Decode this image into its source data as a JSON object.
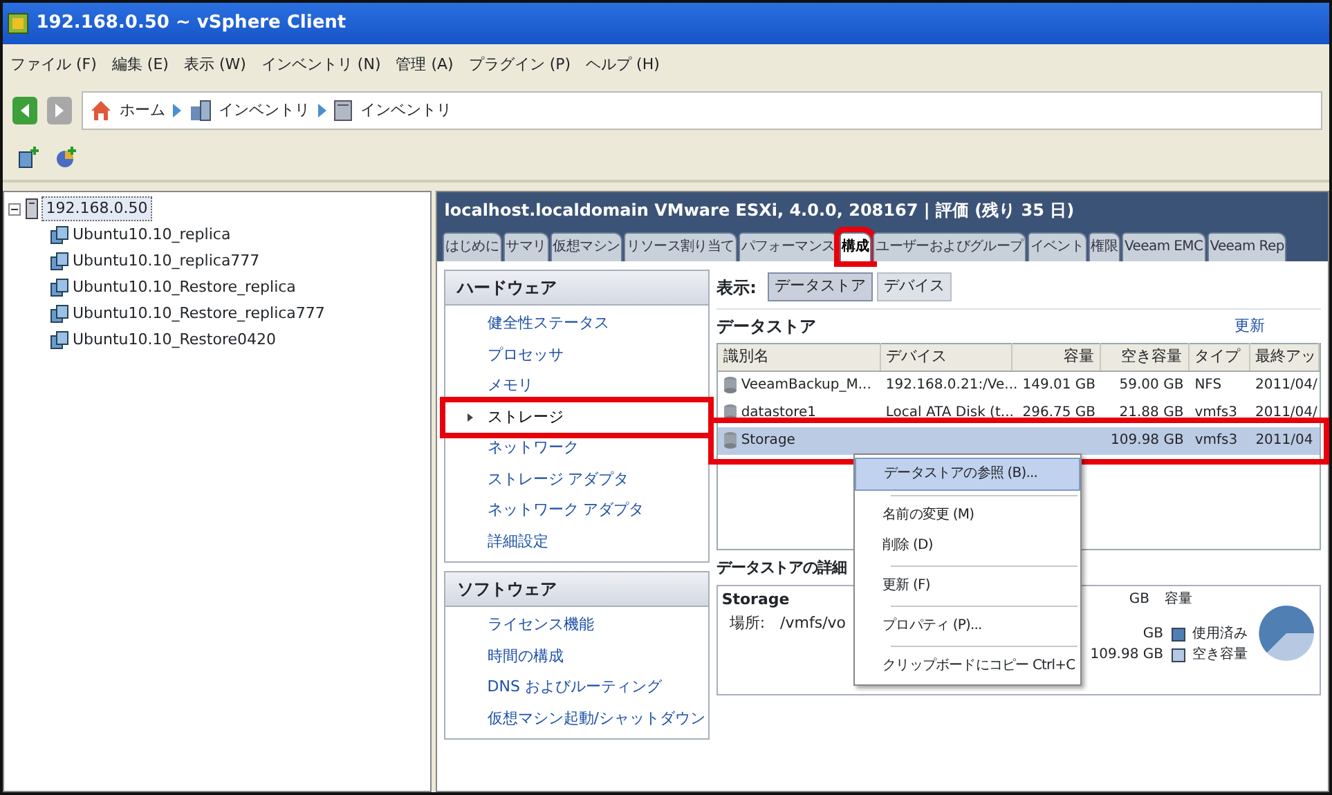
{
  "window": {
    "title": "192.168.0.50 ~ vSphere Client"
  },
  "menu": [
    "ファイル (F)",
    "編集 (E)",
    "表示 (W)",
    "インベントリ (N)",
    "管理 (A)",
    "プラグイン (P)",
    "ヘルプ (H)"
  ],
  "breadcrumb": [
    {
      "kind": "home",
      "label": "ホーム"
    },
    {
      "kind": "inventory",
      "label": "インベントリ"
    },
    {
      "kind": "host",
      "label": "インベントリ"
    }
  ],
  "tree": {
    "label": "192.168.0.50",
    "expanded": true,
    "selected": true,
    "children": [
      {
        "label": "Ubuntu10.10_replica",
        "selected": false
      },
      {
        "label": "Ubuntu10.10_replica777",
        "selected": false
      },
      {
        "label": "Ubuntu10.10_Restore_replica",
        "selected": false
      },
      {
        "label": "Ubuntu10.10_Restore_replica777",
        "selected": false
      },
      {
        "label": "Ubuntu10.10_Restore0420",
        "selected": false
      }
    ]
  },
  "host_header": "localhost.localdomain VMware ESXi, 4.0.0, 208167 | 評価 (残り 35 日)",
  "tabs": [
    {
      "label": "はじめに",
      "selected": false,
      "highlighted": false
    },
    {
      "label": "サマリ",
      "selected": false,
      "highlighted": false
    },
    {
      "label": "仮想マシン",
      "selected": false,
      "highlighted": false
    },
    {
      "label": "リソース割り当て",
      "selected": false,
      "highlighted": false
    },
    {
      "label": "パフォーマンス",
      "selected": false,
      "highlighted": false
    },
    {
      "label": "構成",
      "selected": true,
      "highlighted": true
    },
    {
      "label": "ユーザーおよびグループ",
      "selected": false,
      "highlighted": false
    },
    {
      "label": "イベント",
      "selected": false,
      "highlighted": false
    },
    {
      "label": "権限",
      "selected": false,
      "highlighted": false
    },
    {
      "label": "Veeam EMC",
      "selected": false,
      "highlighted": false
    },
    {
      "label": "Veeam Rep",
      "selected": false,
      "highlighted": false
    }
  ],
  "hardware": {
    "title": "ハードウェア",
    "items": [
      {
        "label": "健全性ステータス",
        "selected": false,
        "highlighted": false
      },
      {
        "label": "プロセッサ",
        "selected": false,
        "highlighted": false
      },
      {
        "label": "メモリ",
        "selected": false,
        "highlighted": false
      },
      {
        "label": "ストレージ",
        "selected": true,
        "highlighted": true
      },
      {
        "label": "ネットワーク",
        "selected": false,
        "highlighted": false
      },
      {
        "label": "ストレージ アダプタ",
        "selected": false,
        "highlighted": false
      },
      {
        "label": "ネットワーク アダプタ",
        "selected": false,
        "highlighted": false
      },
      {
        "label": "詳細設定",
        "selected": false,
        "highlighted": false
      }
    ]
  },
  "software": {
    "title": "ソフトウェア",
    "items": [
      {
        "label": "ライセンス機能",
        "selected": false,
        "highlighted": false
      },
      {
        "label": "時間の構成",
        "selected": false,
        "highlighted": false
      },
      {
        "label": "DNS およびルーティング",
        "selected": false,
        "highlighted": false
      },
      {
        "label": "仮想マシン起動/シャットダウン",
        "selected": false,
        "highlighted": false
      }
    ]
  },
  "view": {
    "label": "表示:",
    "options": [
      {
        "label": "データストア",
        "selected": true
      },
      {
        "label": "デバイス",
        "selected": false
      }
    ]
  },
  "datastores": {
    "title": "データストア",
    "refresh": "更新",
    "columns": [
      "識別名",
      "デバイス",
      "容量",
      "空き容量",
      "タイプ",
      "最終アッ"
    ],
    "rows": [
      {
        "cells": [
          "VeeamBackup_M...",
          "192.168.0.21:/Ve...",
          "149.01 GB",
          "59.00 GB",
          "NFS",
          "2011/04/"
        ],
        "selected": false,
        "highlighted": false
      },
      {
        "cells": [
          "datastore1",
          "Local ATA Disk (t...",
          "296.75 GB",
          "21.88 GB",
          "vmfs3",
          "2011/04/"
        ],
        "selected": false,
        "highlighted": false
      },
      {
        "cells": [
          "Storage",
          null,
          null,
          "109.98 GB",
          "vmfs3",
          "2011/04"
        ],
        "selected": true,
        "highlighted": true
      }
    ]
  },
  "details": {
    "title": "データストアの詳細",
    "name": "Storage",
    "location_label": "場所:",
    "location": "/vmfs/vo",
    "capacity_value": "GB",
    "capacity_label": "容量",
    "legend": [
      {
        "value": "GB",
        "label": "使用済み",
        "color": "#4f7fb3"
      },
      {
        "value": "109.98 GB",
        "label": "空き容量",
        "color": "#b7c9e2"
      }
    ]
  },
  "context_menu": [
    {
      "kind": "item",
      "label": "データストアの参照 (B)...",
      "selected": true
    },
    {
      "kind": "separator"
    },
    {
      "kind": "item",
      "label": "名前の変更 (M)",
      "selected": false
    },
    {
      "kind": "item",
      "label": "削除 (D)",
      "selected": false
    },
    {
      "kind": "separator"
    },
    {
      "kind": "item",
      "label": "更新 (F)",
      "selected": false
    },
    {
      "kind": "separator"
    },
    {
      "kind": "item",
      "label": "プロパティ (P)...",
      "selected": false
    },
    {
      "kind": "separator"
    },
    {
      "kind": "item",
      "label": "クリップボードにコピー Ctrl+C",
      "selected": false
    }
  ]
}
